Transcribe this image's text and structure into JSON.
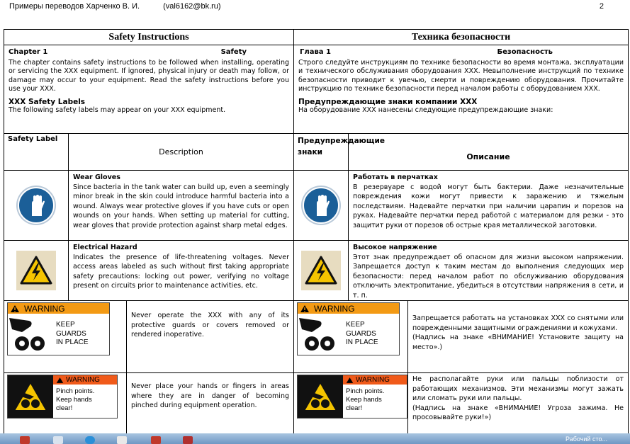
{
  "header": {
    "title": "Примеры переводов Харченко В. И.",
    "email": "(val6162@bk.ru)",
    "page": "2"
  },
  "en": {
    "title": "Safety Instructions",
    "chapter": "Chapter 1",
    "chapter_title": "Safety",
    "intro": "The chapter contains safety instructions to be followed when installing, operating or servicing the XXX equipment. If ignored, physical injury or death may follow, or damage may occur to your equipment. Read the safety instructions before you use your XXX.",
    "labels_heading": "XXX Safety Labels",
    "labels_text": "The following safety labels may appear on your XXX equipment.",
    "col1": "Safety Label",
    "col2": "Description",
    "rows": [
      {
        "title": "Wear Gloves",
        "text": "Since bacteria in the tank water can build up, even a seemingly minor break in the skin could introduce harmful bacteria into a wound. Always wear protective gloves if you have cuts or open wounds on your hands. When setting up material for cutting, wear gloves that provide protection against sharp metal edges."
      },
      {
        "title": "Electrical Hazard",
        "text": "Indicates the presence of life-threatening voltages. Never access areas labeled as such without first taking appropriate safety precautions: locking out power, verifying no voltage present on circuits prior to maintenance activities, etc."
      },
      {
        "text": "Never operate the XXX with any of its protective guards or covers removed or rendered inoperative."
      },
      {
        "text": "Never place your hands or fingers in areas where they are in danger of becoming pinched during equipment operation."
      }
    ]
  },
  "ru": {
    "title": "Техника безопасности",
    "chapter": "Глава 1",
    "chapter_title": "Безопасность",
    "intro": "Строго следуйте инструкциям по технике безопасности во время монтажа, эксплуатации и технического обслуживания оборудования XXX. Невыполнение инструкций по технике безопасности приводит к увечью, смерти и повреждению оборудования. Прочитайте инструкцию по технике безопасности перед началом работы с оборудованием XXX.",
    "labels_heading": "Предупреждающие знаки компании XXX",
    "labels_text": "На оборудование XXX нанесены следующие предупреждающие знаки:",
    "col1": "Предупреждающие знаки",
    "col2": "Описание",
    "rows": [
      {
        "title": "Работать в перчатках",
        "text": "В резервуаре с водой могут быть бактерии. Даже незначительные повреждения кожи могут привести к заражению и тяжелым последствиям. Надевайте перчатки при наличии царапин и порезов на руках. Надевайте перчатки перед работой с материалом для резки - это защитит руки от порезов об острые края металлической заготовки."
      },
      {
        "title": "Высокое напряжение",
        "text": "Этот знак предупреждает об опасном для жизни высоком напряжении. Запрещается доступ к таким местам до выполнения следующих мер безопасности: перед началом работ по обслуживанию оборудования отключить электропитание, убедиться в отсутствии напряжения в сети, и т. п."
      },
      {
        "text": "Запрещается работать на установках XXX со снятыми или поврежденными защитными ограждениями и кожухами.",
        "note": "(Надпись на знаке «ВНИМАНИЕ! Установите защиту на место».)"
      },
      {
        "text": "Не располагайте руки или пальцы поблизости от работающих механизмов. Эти механизмы могут зажать или сломать руки или пальцы.",
        "note": "(Надпись на знаке «ВНИМАНИЕ! Угроза зажима. Не просовывайте руки!»)"
      }
    ]
  },
  "signs": {
    "warning_word": "WARNING",
    "guards_text": [
      "KEEP",
      "GUARDS",
      "IN PLACE"
    ],
    "pinch_text": [
      "Pinch points.",
      "Keep hands",
      "clear!"
    ]
  },
  "taskbar": {
    "text": "Рабочий сто..."
  }
}
